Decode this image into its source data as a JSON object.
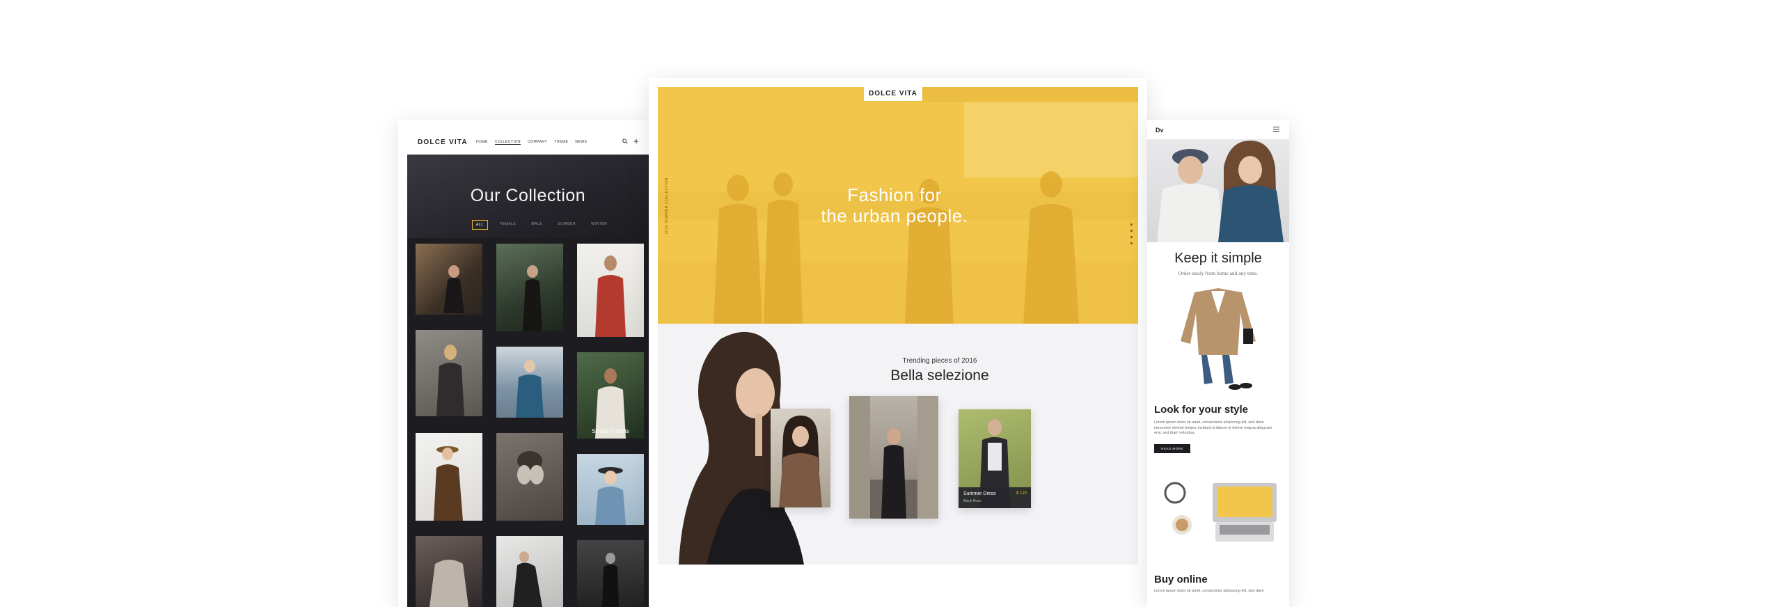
{
  "left_page": {
    "logo": "DOLCE VITA",
    "nav": [
      "HOME",
      "COLLECTION",
      "COMPANY",
      "THEME",
      "NEWS"
    ],
    "active_nav": "COLLECTION",
    "title": "Our Collection",
    "filters": [
      "ALL",
      "FEMALE",
      "MALE",
      "SUMMER",
      "WINTER"
    ],
    "active_filter": "ALL",
    "thumb_caption": "Simple T-Shirts",
    "search_icon": "search-icon",
    "cart_icon": "plus-icon"
  },
  "center_page": {
    "logo": "DOLCE VITA",
    "headline_line1": "Fashion for",
    "headline_line2": "the urban people.",
    "side_text": "2016 SUMMER COLLECTION",
    "kicker": "Trending pieces of 2016",
    "section_title": "Bella selezione",
    "card_title": "Summer Dress",
    "card_subtitle": "Black Rose",
    "card_price": "$ 120",
    "accent_color": "#f1c64a"
  },
  "right_page": {
    "logo": "Dv",
    "heading1": "Keep it simple",
    "subheading1": "Order easily from home and any time.",
    "heading2": "Look for your style",
    "body2": "Lorem ipsum dolor sit amet, consectetur adipiscing elit, sed diam nonummy eirmod tempor invidunt ut labore et dolore magna aliquyam erat, sed diam voluptua.",
    "button_label": "READ MORE",
    "heading3": "Buy online",
    "body3": "Lorem ipsum dolor sit amet, consectetur adipiscing elit, sed diam"
  }
}
